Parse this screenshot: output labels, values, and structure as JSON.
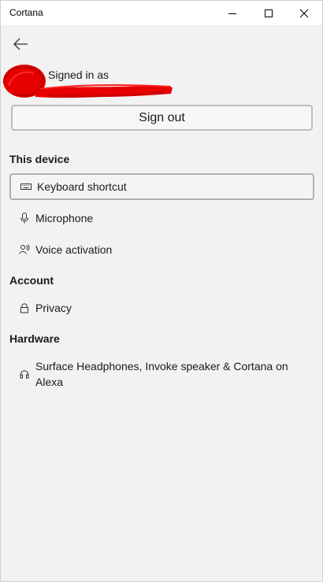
{
  "window": {
    "title": "Cortana",
    "controls": {
      "minimize_icon": "minimize-icon",
      "maximize_icon": "maximize-icon",
      "close_icon": "close-icon"
    }
  },
  "header": {
    "back_icon": "back-arrow-icon"
  },
  "account": {
    "signed_in_label": "Signed in as",
    "avatar_icon": "avatar",
    "sign_out_label": "Sign out"
  },
  "sections": {
    "this_device": {
      "heading": "This device",
      "items": [
        {
          "label": "Keyboard shortcut",
          "icon": "keyboard-icon",
          "selected": true
        },
        {
          "label": "Microphone",
          "icon": "microphone-icon",
          "selected": false
        },
        {
          "label": "Voice activation",
          "icon": "voice-activation-icon",
          "selected": false
        }
      ]
    },
    "account": {
      "heading": "Account",
      "items": [
        {
          "label": "Privacy",
          "icon": "lock-icon",
          "selected": false
        }
      ]
    },
    "hardware": {
      "heading": "Hardware",
      "items": [
        {
          "label": "Surface Headphones, Invoke speaker & Cortana on Alexa",
          "icon": "headphones-icon",
          "selected": false
        }
      ]
    }
  },
  "colors": {
    "background": "#f2f2f2",
    "titlebar": "#ffffff",
    "redaction": "#e60000",
    "border": "#bdbdbd"
  }
}
